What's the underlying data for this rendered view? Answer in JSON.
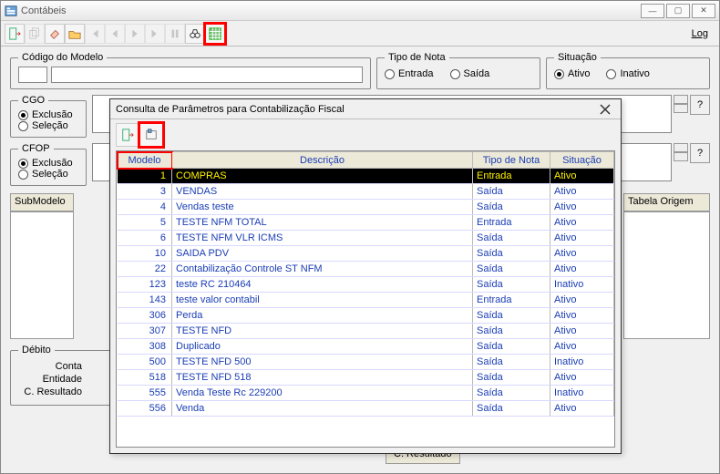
{
  "window": {
    "title": "Contábeis",
    "log_label": "Log"
  },
  "toolbar_icons": [
    "exit-icon",
    "clone-icon",
    "eraser-icon",
    "open-icon",
    "nav-first-icon",
    "nav-prev-icon",
    "nav-next-icon",
    "nav-last-icon",
    "pause-icon",
    "binoculars-icon",
    "grid-icon"
  ],
  "groupbox": {
    "codigo": "Código do Modelo",
    "tipo": "Tipo de Nota",
    "situacao": "Situação",
    "cgo": "CGO",
    "cfop": "CFOP",
    "debito": "Débito",
    "conta": "Conta",
    "entidade": "Entidade",
    "cresultado": "C. Resultado"
  },
  "radios": {
    "entrada": "Entrada",
    "saida": "Saída",
    "ativo": "Ativo",
    "inativo": "Inativo",
    "exclusao": "Exclusão",
    "selecao": "Seleção"
  },
  "headers": {
    "submodelo": "SubModelo",
    "tabela_origem": "Tabela Origem"
  },
  "bottom_button": "C. Resultado",
  "modal": {
    "title": "Consulta de Parâmetros para Contabilização Fiscal",
    "columns": {
      "modelo": "Modelo",
      "descricao": "Descrição",
      "tipo": "Tipo de Nota",
      "situacao": "Situação"
    },
    "rows": [
      {
        "modelo": "1",
        "desc": "COMPRAS",
        "tipo": "Entrada",
        "sit": "Ativo",
        "selected": true
      },
      {
        "modelo": "3",
        "desc": "VENDAS",
        "tipo": "Saída",
        "sit": "Ativo"
      },
      {
        "modelo": "4",
        "desc": "Vendas teste",
        "tipo": "Saída",
        "sit": "Ativo"
      },
      {
        "modelo": "5",
        "desc": "TESTE NFM TOTAL",
        "tipo": "Entrada",
        "sit": "Ativo"
      },
      {
        "modelo": "6",
        "desc": "TESTE NFM VLR ICMS",
        "tipo": "Saída",
        "sit": "Ativo"
      },
      {
        "modelo": "10",
        "desc": "SAIDA PDV",
        "tipo": "Saída",
        "sit": "Ativo"
      },
      {
        "modelo": "22",
        "desc": "Contabilização Controle ST NFM",
        "tipo": "Saída",
        "sit": "Ativo"
      },
      {
        "modelo": "123",
        "desc": "teste RC 210464",
        "tipo": "Saída",
        "sit": "Inativo"
      },
      {
        "modelo": "143",
        "desc": "teste valor contabil",
        "tipo": "Entrada",
        "sit": "Ativo"
      },
      {
        "modelo": "306",
        "desc": "Perda",
        "tipo": "Saída",
        "sit": "Ativo"
      },
      {
        "modelo": "307",
        "desc": "TESTE NFD",
        "tipo": "Saída",
        "sit": "Ativo"
      },
      {
        "modelo": "308",
        "desc": "Duplicado",
        "tipo": "Saída",
        "sit": "Ativo"
      },
      {
        "modelo": "500",
        "desc": "TESTE NFD 500",
        "tipo": "Saída",
        "sit": "Inativo"
      },
      {
        "modelo": "518",
        "desc": "TESTE NFD 518",
        "tipo": "Saída",
        "sit": "Ativo"
      },
      {
        "modelo": "555",
        "desc": "Venda Teste Rc 229200",
        "tipo": "Saída",
        "sit": "Inativo"
      },
      {
        "modelo": "556",
        "desc": "Venda",
        "tipo": "Saída",
        "sit": "Ativo"
      }
    ]
  }
}
